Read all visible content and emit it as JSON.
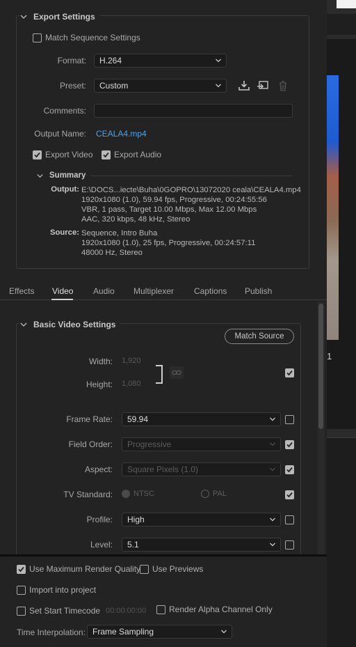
{
  "export_settings": {
    "section_title": "Export Settings",
    "match_sequence_label": "Match Sequence Settings",
    "match_sequence_checked": false,
    "format_label": "Format:",
    "format_value": "H.264",
    "preset_label": "Preset:",
    "preset_value": "Custom",
    "comments_label": "Comments:",
    "comments_value": "",
    "output_name_label": "Output Name:",
    "output_name_value": "CEALA4.mp4",
    "export_video_label": "Export Video",
    "export_video_checked": true,
    "export_audio_label": "Export Audio",
    "export_audio_checked": true,
    "icons": [
      "save-preset-icon",
      "import-preset-icon",
      "delete-preset-icon"
    ]
  },
  "summary": {
    "title": "Summary",
    "output_label": "Output:",
    "output_lines": [
      "E:\\DOCS...iecte\\Buha\\0GOPRO\\13072020 ceala\\CEALA4.mp4",
      "1920x1080 (1.0), 59.94 fps, Progressive, 00:24:55:56",
      "VBR, 1 pass, Target 10.00 Mbps, Max 12.00 Mbps",
      "AAC, 320 kbps, 48 kHz, Stereo"
    ],
    "source_label": "Source:",
    "source_lines": [
      "Sequence, Intro Buha",
      "1920x1080 (1.0), 25 fps, Progressive, 00:24:57:11",
      "48000 Hz, Stereo"
    ]
  },
  "tabs": [
    "Effects",
    "Video",
    "Audio",
    "Multiplexer",
    "Captions",
    "Publish"
  ],
  "active_tab": "Video",
  "basic_video": {
    "section_title": "Basic Video Settings",
    "match_source_label": "Match Source",
    "width_label": "Width:",
    "width_value": "1,920",
    "height_label": "Height:",
    "height_value": "1,080",
    "frame_rate_label": "Frame Rate:",
    "frame_rate_value": "59.94",
    "field_order_label": "Field Order:",
    "field_order_value": "Progressive",
    "aspect_label": "Aspect:",
    "aspect_value": "Square Pixels (1.0)",
    "tv_standard_label": "TV Standard:",
    "ntsc_label": "NTSC",
    "pal_label": "PAL",
    "profile_label": "Profile:",
    "profile_value": "High",
    "level_label": "Level:",
    "level_value": "5.1"
  },
  "bottom": {
    "max_render_label": "Use Maximum Render Quality",
    "max_render_checked": true,
    "use_previews_label": "Use Previews",
    "use_previews_checked": false,
    "import_label": "Import into project",
    "import_checked": false,
    "start_tc_label": "Set Start Timecode",
    "start_tc_checked": false,
    "start_tc_value": "00:00:00:00",
    "alpha_label": "Render Alpha Channel Only",
    "alpha_checked": false,
    "time_interp_label": "Time Interpolation:",
    "time_interp_value": "Frame Sampling"
  },
  "preview_side": {
    "frame_marker": "1"
  },
  "colors": {
    "bg": "#232323",
    "link": "#4da1e8",
    "preview_sky": "#1e5bd0",
    "preview_ground": "#8b6a55"
  }
}
